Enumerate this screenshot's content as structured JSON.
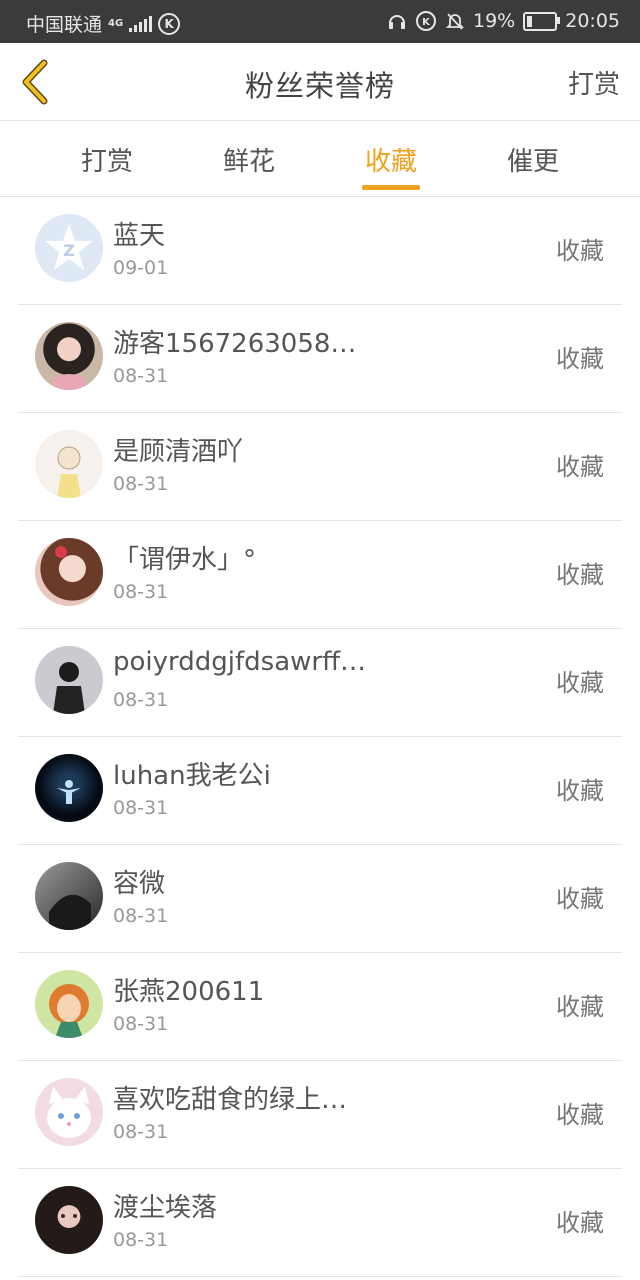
{
  "status_bar": {
    "carrier": "中国联通",
    "network": "4G",
    "battery_percent": "19%",
    "battery_level": 0.19,
    "time": "20:05"
  },
  "header": {
    "title": "粉丝荣誉榜",
    "action": "打赏"
  },
  "tabs": [
    "打赏",
    "鲜花",
    "收藏",
    "催更"
  ],
  "active_tab": "收藏",
  "accent_color": "#f0a11e",
  "rows": [
    {
      "name": "蓝天",
      "date": "09-01",
      "action": "收藏"
    },
    {
      "name": "游客1567263058…",
      "date": "08-31",
      "action": "收藏"
    },
    {
      "name": "是顾清酒吖",
      "date": "08-31",
      "action": "收藏"
    },
    {
      "name": "「谓伊水」°",
      "date": "08-31",
      "action": "收藏"
    },
    {
      "name": "poiyrddgjfdsawrff…",
      "date": "08-31",
      "action": "收藏"
    },
    {
      "name": "luhan我老公i",
      "date": "08-31",
      "action": "收藏"
    },
    {
      "name": "容微",
      "date": "08-31",
      "action": "收藏"
    },
    {
      "name": "张燕200611",
      "date": "08-31",
      "action": "收藏"
    },
    {
      "name": "喜欢吃甜食的绿上…",
      "date": "08-31",
      "action": "收藏"
    },
    {
      "name": "渡尘埃落",
      "date": "08-31",
      "action": "收藏"
    }
  ]
}
